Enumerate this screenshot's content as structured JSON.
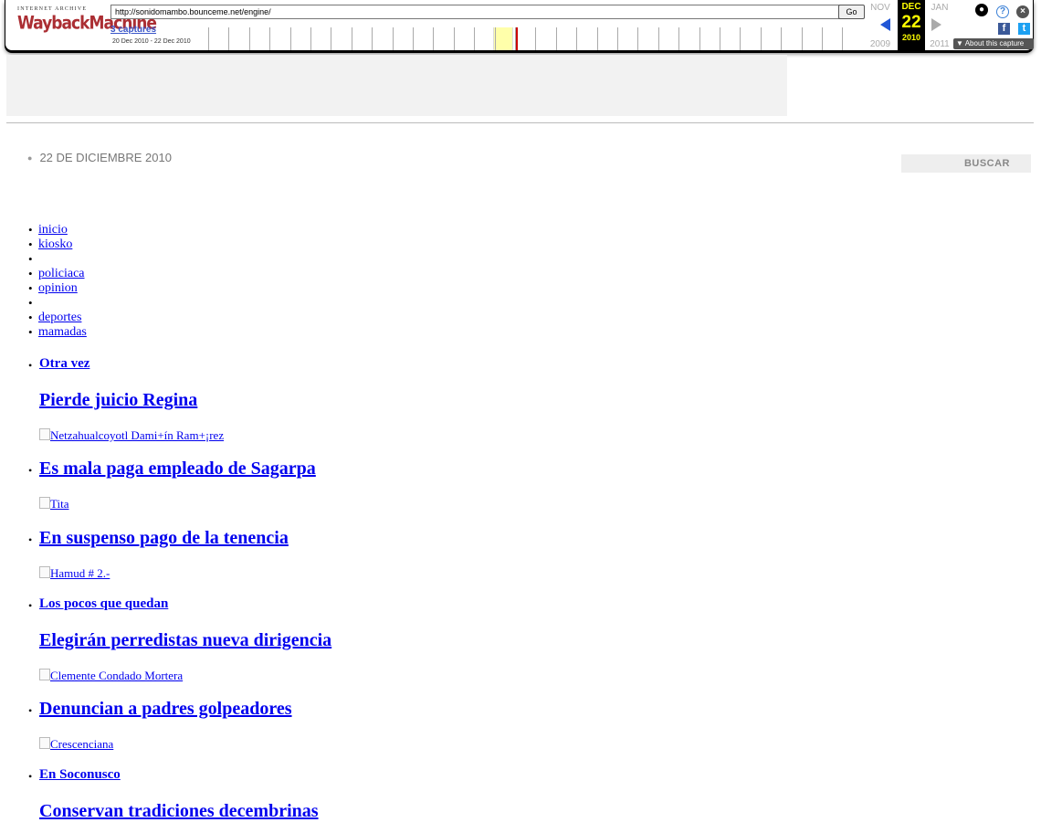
{
  "wayback": {
    "logo_top": "INTERNET ARCHIVE",
    "logo_main": "WaybackMachine",
    "url": "http://sonidomambo.bounceme.net/engine/",
    "go_label": "Go",
    "captures_label": "3 captures",
    "date_range": "20 Dec 2010 - 22 Dec 2010",
    "prev_month": "NOV",
    "cur_month": "DEC",
    "next_month": "JAN",
    "cur_day": "22",
    "prev_year": "2009",
    "cur_year": "2010",
    "next_year": "2011",
    "about_label": "About this capture",
    "icons": [
      "user-icon",
      "help-icon",
      "close-icon",
      "facebook-icon",
      "twitter-icon"
    ]
  },
  "header": {
    "date": "22 DE DICIEMBRE 2010",
    "search_label": "BUSCAR"
  },
  "nav": {
    "inicio": "inicio",
    "kiosko": "kiosko",
    "policiaca": "policiaca",
    "opinion": "opinion",
    "deportes": "deportes",
    "mamadas": "mamadas"
  },
  "stories": {
    "s1_kicker": "Otra vez",
    "s1_title": "Pierde juicio Regina",
    "s1_img": "Netzahualcoyotl Dami+ín Ram+¡rez",
    "s2_title": "Es mala paga empleado de Sagarpa",
    "s2_img": "Tita",
    "s3_title": "En suspenso pago de la tenencia",
    "s3_img": "Hamud # 2.-",
    "s4_kicker": "Los pocos que quedan",
    "s4_title": "Elegirán perredistas nueva dirigencia",
    "s4_img": "Clemente Condado Mortera",
    "s5_title": "Denuncian a padres golpeadores",
    "s5_img": "Crescenciana",
    "s6_kicker": "En Soconusco",
    "s6_title": "Conservan tradiciones decembrinas"
  }
}
